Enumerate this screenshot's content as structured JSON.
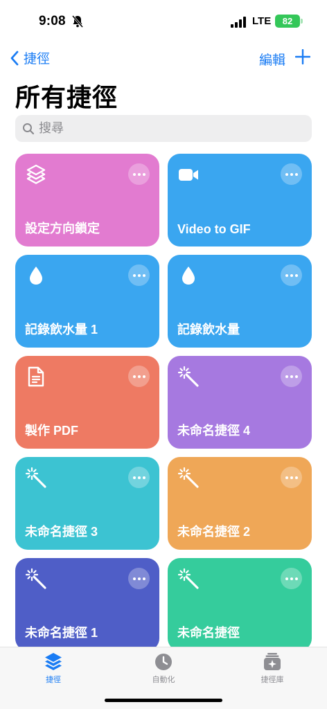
{
  "status": {
    "time": "9:08",
    "network": "LTE",
    "battery": "82"
  },
  "nav": {
    "back_label": "捷徑",
    "edit_label": "編輯"
  },
  "page": {
    "title": "所有捷徑"
  },
  "search": {
    "placeholder": "搜尋"
  },
  "shortcuts": [
    {
      "title": "設定方向鎖定",
      "icon": "layers-icon",
      "color": "#e27bd0"
    },
    {
      "title": "Video to GIF",
      "icon": "video-camera-icon",
      "color": "#3aa6f0"
    },
    {
      "title": "記錄飲水量 1",
      "icon": "water-drop-icon",
      "color": "#3aa6f0"
    },
    {
      "title": "記錄飲水量",
      "icon": "water-drop-icon",
      "color": "#3aa6f0"
    },
    {
      "title": "製作 PDF",
      "icon": "document-icon",
      "color": "#ee7a63"
    },
    {
      "title": "未命名捷徑 4",
      "icon": "magic-wand-icon",
      "color": "#a679e0"
    },
    {
      "title": "未命名捷徑 3",
      "icon": "magic-wand-icon",
      "color": "#3cc3d2"
    },
    {
      "title": "未命名捷徑 2",
      "icon": "magic-wand-icon",
      "color": "#efa757"
    },
    {
      "title": "未命名捷徑 1",
      "icon": "magic-wand-icon",
      "color": "#4f5ec7"
    },
    {
      "title": "未命名捷徑",
      "icon": "magic-wand-icon",
      "color": "#35cc9c"
    }
  ],
  "tabs": [
    {
      "label": "捷徑",
      "icon": "shortcuts-stack-icon",
      "active": true
    },
    {
      "label": "自動化",
      "icon": "clock-check-icon",
      "active": false
    },
    {
      "label": "捷徑庫",
      "icon": "gallery-icon",
      "active": false
    }
  ],
  "colors": {
    "accent": "#1a7cf4",
    "battery": "#34c759",
    "tab_inactive": "#8e8e93"
  }
}
